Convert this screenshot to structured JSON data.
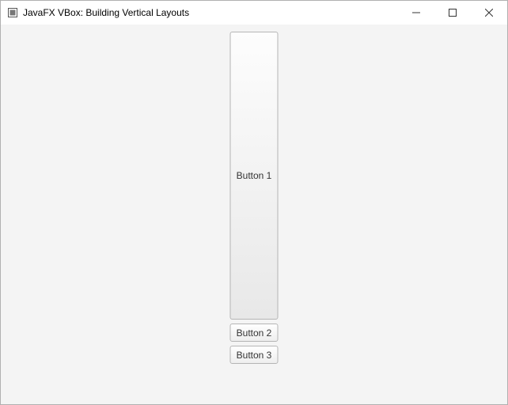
{
  "window": {
    "title": "JavaFX VBox: Building Vertical Layouts"
  },
  "buttons": {
    "b1": "Button 1",
    "b2": "Button 2",
    "b3": "Button 3"
  }
}
